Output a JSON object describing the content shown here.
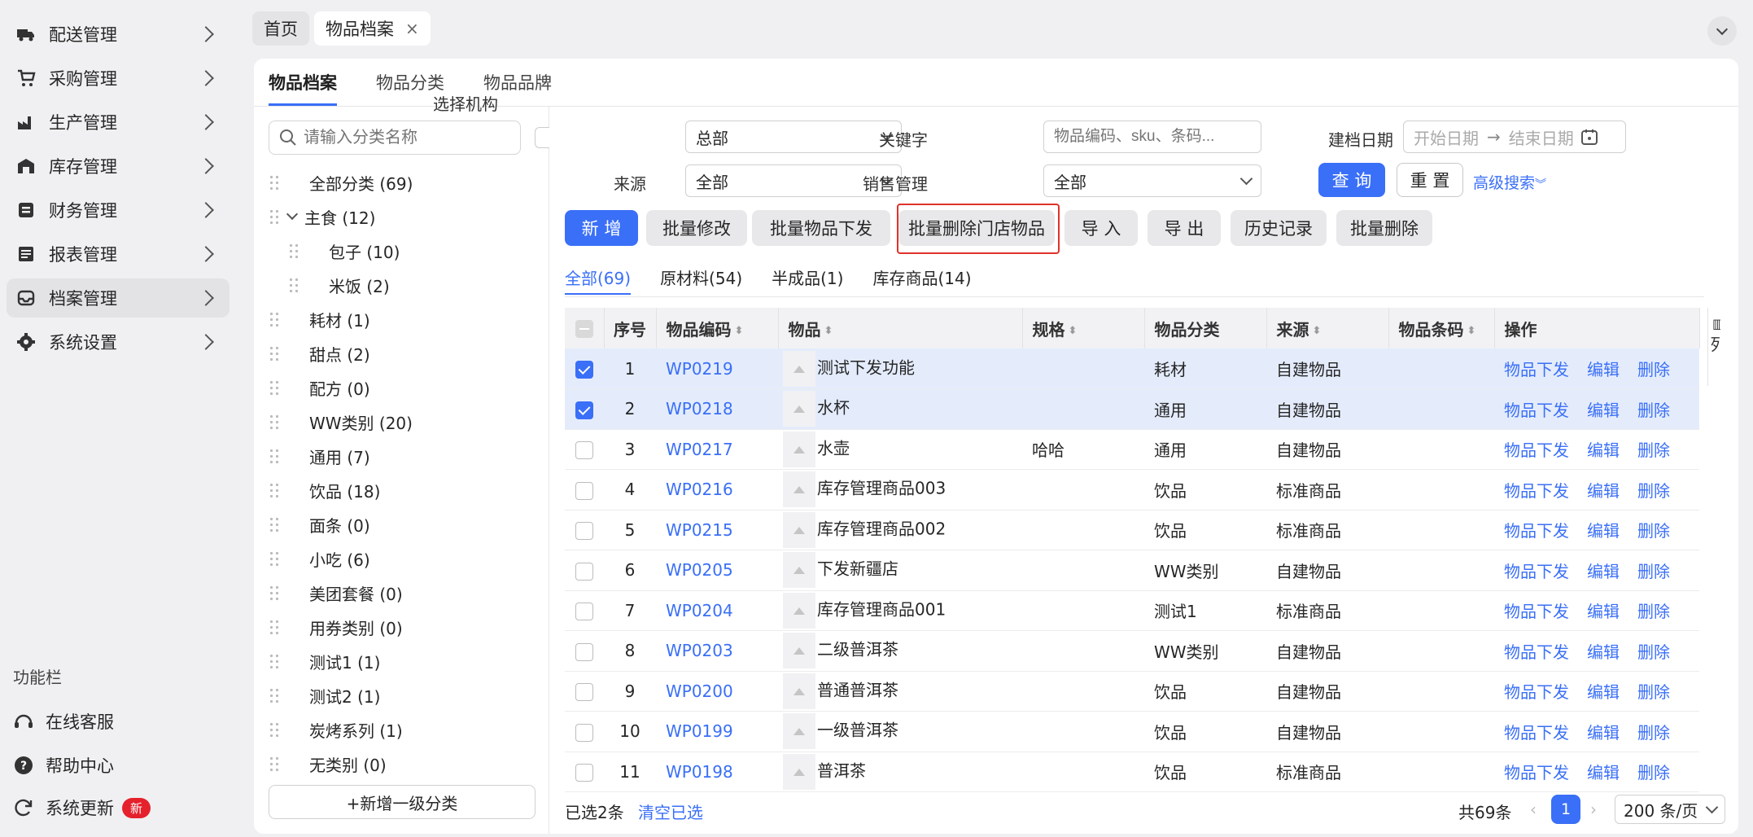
{
  "sidebar": {
    "items": [
      {
        "label": "配送管理",
        "icon": "truck-icon"
      },
      {
        "label": "采购管理",
        "icon": "cart-icon"
      },
      {
        "label": "生产管理",
        "icon": "factory-icon"
      },
      {
        "label": "库存管理",
        "icon": "warehouse-icon"
      },
      {
        "label": "财务管理",
        "icon": "finance-icon"
      },
      {
        "label": "报表管理",
        "icon": "report-icon"
      },
      {
        "label": "档案管理",
        "icon": "archive-icon"
      },
      {
        "label": "系统设置",
        "icon": "gear-icon"
      }
    ],
    "func_title": "功能栏",
    "bottom": [
      {
        "label": "在线客服",
        "icon": "headset-icon"
      },
      {
        "label": "帮助中心",
        "icon": "help-icon"
      },
      {
        "label": "系统更新",
        "icon": "refresh-icon",
        "badge": "新"
      }
    ]
  },
  "top_tabs": [
    {
      "label": "首页"
    },
    {
      "label": "物品档案",
      "close": "×"
    }
  ],
  "sub_tabs": [
    "物品档案",
    "物品分类",
    "物品品牌"
  ],
  "tree": {
    "search_placeholder": "请输入分类名称",
    "items": [
      "全部分类 (69)",
      "主食 (12)",
      "包子 (10)",
      "米饭 (2)",
      "耗材 (1)",
      "甜点 (2)",
      "配方 (0)",
      "WW类别 (20)",
      "通用 (7)",
      "饮品 (18)",
      "面条 (0)",
      "小吃 (6)",
      "美团套餐 (0)",
      "用券类别 (0)",
      "测试1 (1)",
      "测试2 (1)",
      "炭烤系列 (1)",
      "无类别 (0)"
    ],
    "add_label": "+新增一级分类"
  },
  "filters": {
    "org_label": "选择机构",
    "org_value": "总部",
    "keyword_label": "关键字",
    "keyword_placeholder": "物品编码、sku、条码...",
    "date_label": "建档日期",
    "date_start": "开始日期",
    "date_arrow": "→",
    "date_end": "结束日期",
    "source_label": "来源",
    "source_value": "全部",
    "sales_label": "销售管理",
    "sales_value": "全部",
    "query": "查 询",
    "reset": "重 置",
    "advanced": "高级搜索"
  },
  "actions": [
    "新 增",
    "批量修改",
    "批量物品下发",
    "批量删除门店物品",
    "导 入",
    "导 出",
    "历史记录",
    "批量删除"
  ],
  "type_tabs": [
    "全部(69)",
    "原材料(54)",
    "半成品(1)",
    "库存商品(14)"
  ],
  "table": {
    "headers": [
      "序号",
      "物品编码",
      "物品",
      "规格",
      "物品分类",
      "来源",
      "物品条码",
      "操作"
    ],
    "col_settings": "列",
    "op_labels": [
      "物品下发",
      "编辑",
      "删除"
    ],
    "rows": [
      {
        "no": "1",
        "code": "WP0219",
        "name": "测试下发功能",
        "spec": "",
        "category": "耗材",
        "source": "自建物品",
        "barcode": "",
        "selected": true
      },
      {
        "no": "2",
        "code": "WP0218",
        "name": "水杯",
        "spec": "",
        "category": "通用",
        "source": "自建物品",
        "barcode": "",
        "selected": true
      },
      {
        "no": "3",
        "code": "WP0217",
        "name": "水壶",
        "spec": "哈哈",
        "category": "通用",
        "source": "自建物品",
        "barcode": "",
        "selected": false
      },
      {
        "no": "4",
        "code": "WP0216",
        "name": "库存管理商品003",
        "spec": "",
        "category": "饮品",
        "source": "标准商品",
        "barcode": "",
        "selected": false
      },
      {
        "no": "5",
        "code": "WP0215",
        "name": "库存管理商品002",
        "spec": "",
        "category": "饮品",
        "source": "标准商品",
        "barcode": "",
        "selected": false
      },
      {
        "no": "6",
        "code": "WP0205",
        "name": "下发新疆店",
        "spec": "",
        "category": "WW类别",
        "source": "自建物品",
        "barcode": "",
        "selected": false
      },
      {
        "no": "7",
        "code": "WP0204",
        "name": "库存管理商品001",
        "spec": "",
        "category": "测试1",
        "source": "标准商品",
        "barcode": "",
        "selected": false
      },
      {
        "no": "8",
        "code": "WP0203",
        "name": "二级普洱茶",
        "spec": "",
        "category": "WW类别",
        "source": "自建物品",
        "barcode": "",
        "selected": false
      },
      {
        "no": "9",
        "code": "WP0200",
        "name": "普通普洱茶",
        "spec": "",
        "category": "饮品",
        "source": "自建物品",
        "barcode": "",
        "selected": false
      },
      {
        "no": "10",
        "code": "WP0199",
        "name": "一级普洱茶",
        "spec": "",
        "category": "饮品",
        "source": "自建物品",
        "barcode": "",
        "selected": false
      },
      {
        "no": "11",
        "code": "WP0198",
        "name": "普洱茶",
        "spec": "",
        "category": "饮品",
        "source": "标准商品",
        "barcode": "",
        "selected": false
      }
    ]
  },
  "footer": {
    "selected_text": "已选2条",
    "clear": "清空已选",
    "total": "共69条",
    "page": "1",
    "page_size": "200 条/页"
  },
  "colors": {
    "accent": "#3a6ff7",
    "highlight": "#e0322a",
    "badge": "#e5212b"
  }
}
